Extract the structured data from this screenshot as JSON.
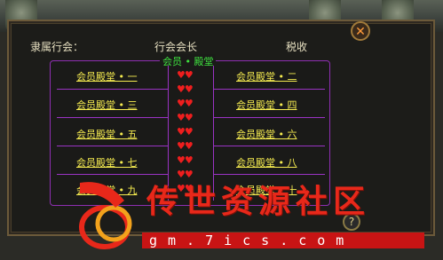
{
  "header": {
    "guild_label": "隶属行会：",
    "leader_label": "行会会长",
    "tax_label": "税收",
    "close_icon": "close-icon"
  },
  "members_frame": {
    "title": "会员 • 殿堂",
    "left_halls": [
      "会员殿堂 • 一",
      "会员殿堂 • 三",
      "会员殿堂 • 五",
      "会员殿堂 • 七",
      "会员殿堂 • 九"
    ],
    "right_halls": [
      "会员殿堂 • 二",
      "会员殿堂 • 四",
      "会员殿堂 • 六",
      "会员殿堂 • 八",
      "会员殿堂 • 十"
    ],
    "hearts": [
      "♥♥",
      "♥♥",
      "♥♥",
      "♥♥",
      "♥♥",
      "♥♥",
      "♥♥",
      "♥♥",
      "♥♥"
    ]
  },
  "help_icon": "help-icon",
  "watermark": {
    "title": "传世资源社区",
    "url": "gm.7ics.com"
  },
  "colors": {
    "accent_purple": "#9a33c4",
    "hall_text": "#f6ec50",
    "title_green": "#3fe23f",
    "heart_red": "#ee1e1e",
    "watermark_red": "#e8281a"
  }
}
